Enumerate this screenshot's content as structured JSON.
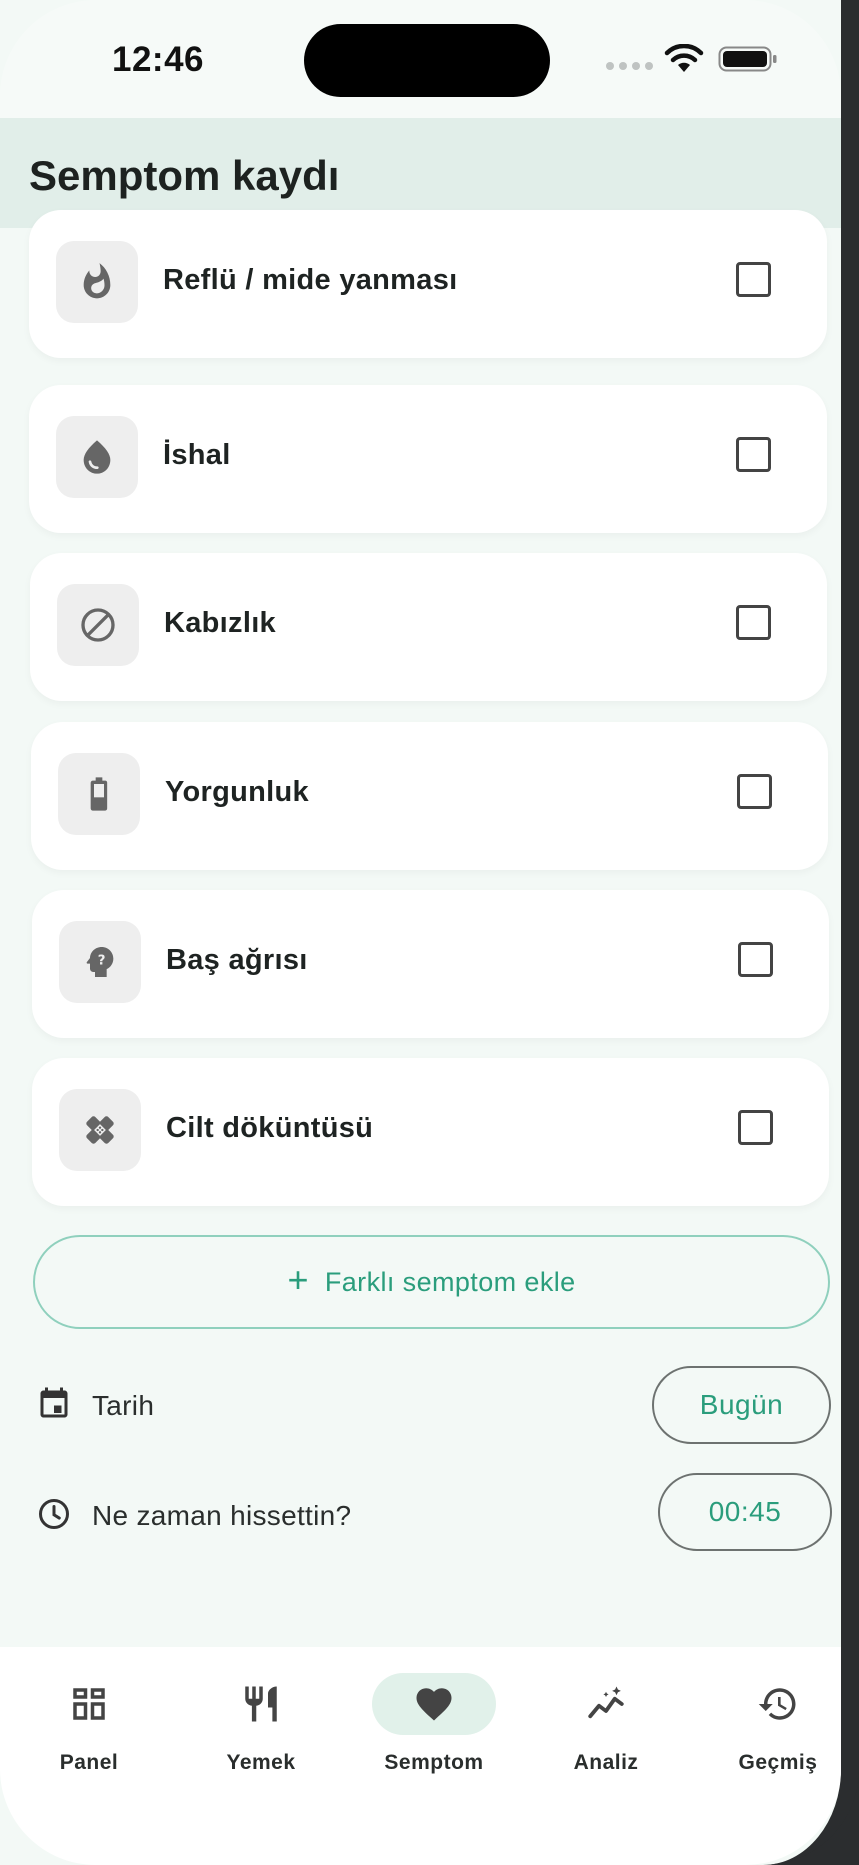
{
  "status_bar": {
    "time": "12:46"
  },
  "header": {
    "title": "Semptom kaydı"
  },
  "symptoms": [
    {
      "label": "Reflü / mide yanması",
      "icon": "flame-icon",
      "checked": false
    },
    {
      "label": "İshal",
      "icon": "drop-icon",
      "checked": false
    },
    {
      "label": "Kabızlık",
      "icon": "block-icon",
      "checked": false
    },
    {
      "label": "Yorgunluk",
      "icon": "battery-low-icon",
      "checked": false
    },
    {
      "label": "Baş ağrısı",
      "icon": "head-question-icon",
      "checked": false
    },
    {
      "label": "Cilt döküntüsü",
      "icon": "bandage-icon",
      "checked": false
    }
  ],
  "add_button": {
    "label": "Farklı semptom ekle"
  },
  "date_row": {
    "label": "Tarih",
    "value": "Bugün"
  },
  "time_row": {
    "label": "Ne zaman hissettin?",
    "value": "00:45"
  },
  "nav": {
    "items": [
      {
        "label": "Panel",
        "icon": "dashboard-icon"
      },
      {
        "label": "Yemek",
        "icon": "restaurant-icon"
      },
      {
        "label": "Semptom",
        "icon": "heart-icon",
        "active": true
      },
      {
        "label": "Analiz",
        "icon": "sparkle-chart-icon"
      },
      {
        "label": "Geçmiş",
        "icon": "history-icon"
      }
    ]
  },
  "colors": {
    "accent": "#2a9d7c",
    "header_bg": "#e1eee9",
    "page_bg": "#f3f9f6"
  }
}
